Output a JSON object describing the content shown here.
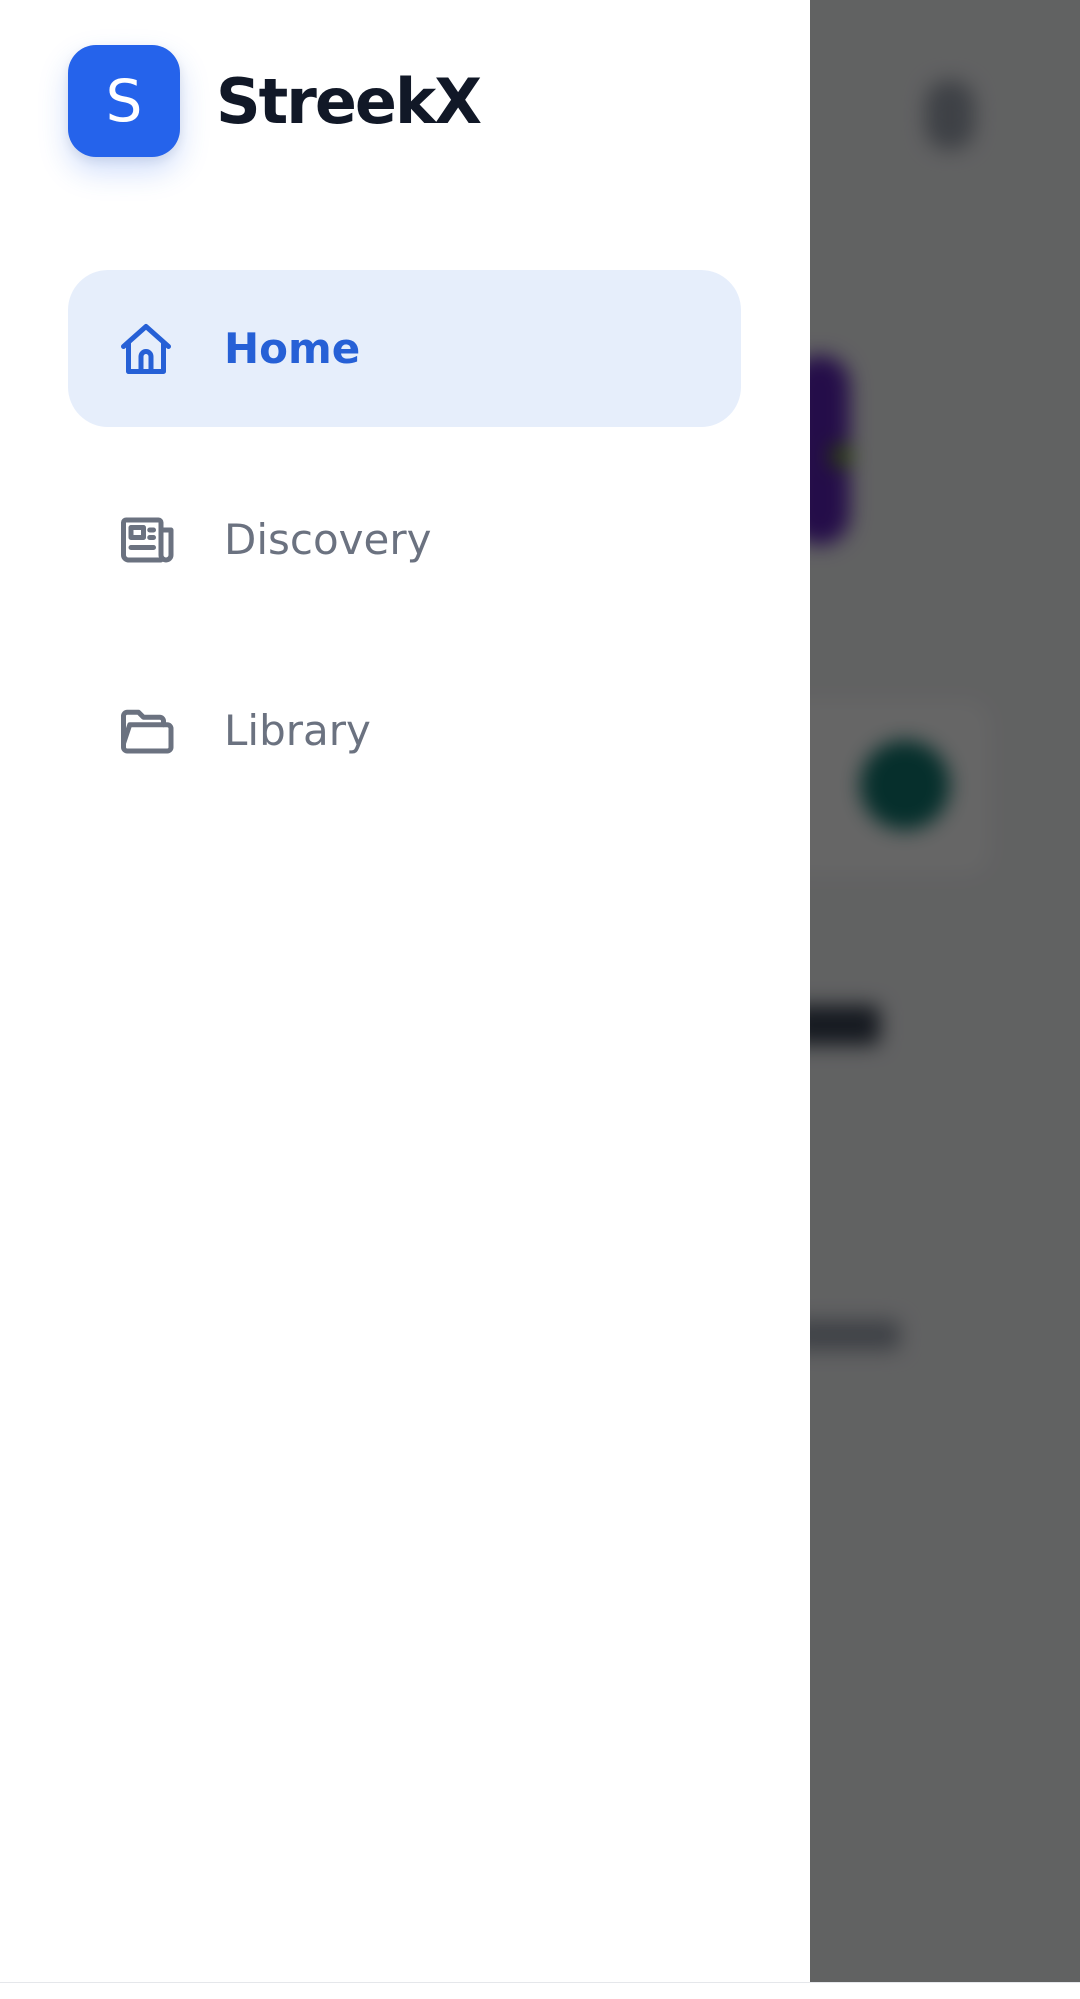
{
  "brand": {
    "logo_letter": "S",
    "name": "StreekX",
    "color": "#2563eb"
  },
  "nav": {
    "items": [
      {
        "label": "Home",
        "icon": "home-icon",
        "active": true
      },
      {
        "label": "Discovery",
        "icon": "newspaper-icon",
        "active": false
      },
      {
        "label": "Library",
        "icon": "folder-icon",
        "active": false
      }
    ]
  },
  "colors": {
    "active_text": "#2660d6",
    "active_background": "#e6eefb",
    "inactive_text": "#6b7280",
    "scrim": "rgba(0,0,0,0.6)"
  }
}
